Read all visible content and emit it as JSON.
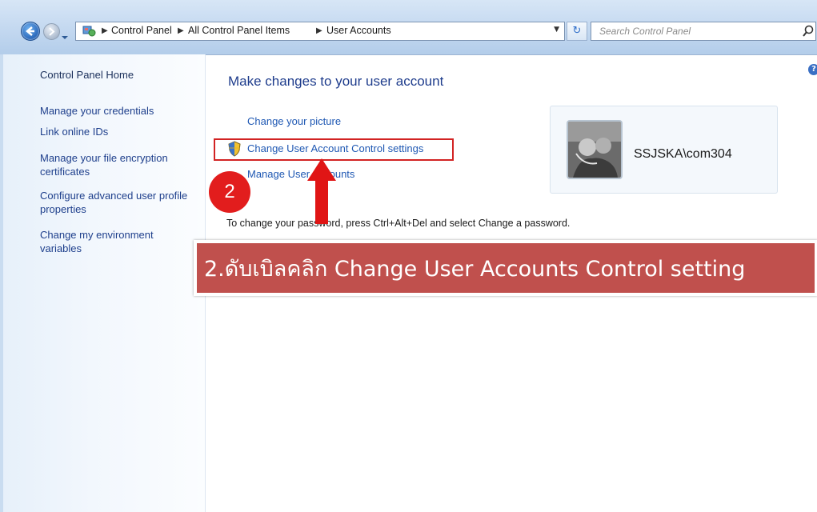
{
  "address_bar": {
    "breadcrumbs": [
      "Control Panel",
      "All Control Panel Items",
      "User Accounts"
    ]
  },
  "search": {
    "placeholder": "Search Control Panel"
  },
  "sidebar": {
    "home": "Control Panel Home",
    "items": [
      "Manage your credentials",
      "Link online IDs",
      "Manage your file encryption certificates",
      "Configure advanced user profile properties",
      "Change my environment variables"
    ]
  },
  "main": {
    "title": "Make changes to your user account",
    "links": [
      "Change your picture",
      "Change User Account Control settings",
      "Manage User Accounts"
    ],
    "password_note": "To change your password, press Ctrl+Alt+Del and select Change a password."
  },
  "user": {
    "name": "SSJSKA\\com304"
  },
  "annotation": {
    "step_number": "2",
    "instruction": "2.ดับเบิลคลิก Change User Accounts Control setting",
    "color": "#c0504d",
    "highlight_color": "#d22323"
  }
}
